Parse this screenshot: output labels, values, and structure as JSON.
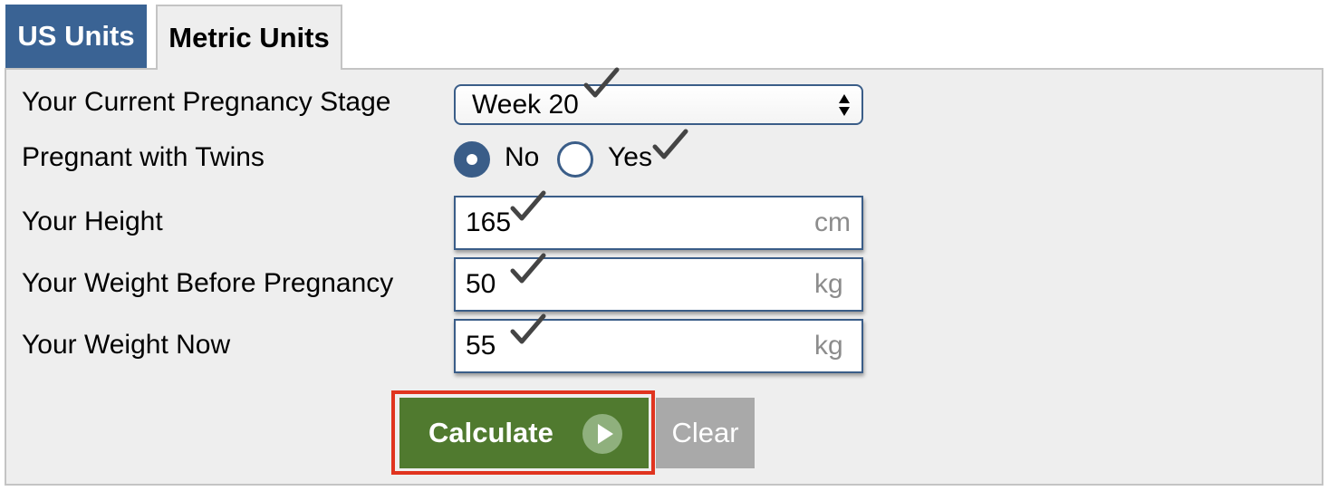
{
  "tabs": {
    "us_units": "US Units",
    "metric_units": "Metric Units",
    "active": "Metric Units"
  },
  "form": {
    "pregnancy_stage_label": "Your Current Pregnancy Stage",
    "pregnancy_stage_value": "Week 20",
    "twins_label": "Pregnant with Twins",
    "twins_options": [
      "No",
      "Yes"
    ],
    "twins_selected": "No",
    "height_label": "Your Height",
    "height_value": "165",
    "height_unit": "cm",
    "weight_before_label": "Your Weight Before Pregnancy",
    "weight_before_value": "50",
    "weight_before_unit": "kg",
    "weight_now_label": "Your Weight Now",
    "weight_now_value": "55",
    "weight_now_unit": "kg"
  },
  "buttons": {
    "calculate": "Calculate",
    "clear": "Clear"
  },
  "colors": {
    "tab_active_bg": "#3a6394",
    "panel_bg": "#eeeeee",
    "field_border": "#3a5d88",
    "calculate_bg": "#507a2f",
    "clear_bg": "#a9a9a9",
    "highlight_outline": "#e0341f"
  },
  "icons": {
    "select_arrows": "updown-arrows-icon",
    "play": "play-circle-icon",
    "checkmark": "checkmark-icon"
  }
}
